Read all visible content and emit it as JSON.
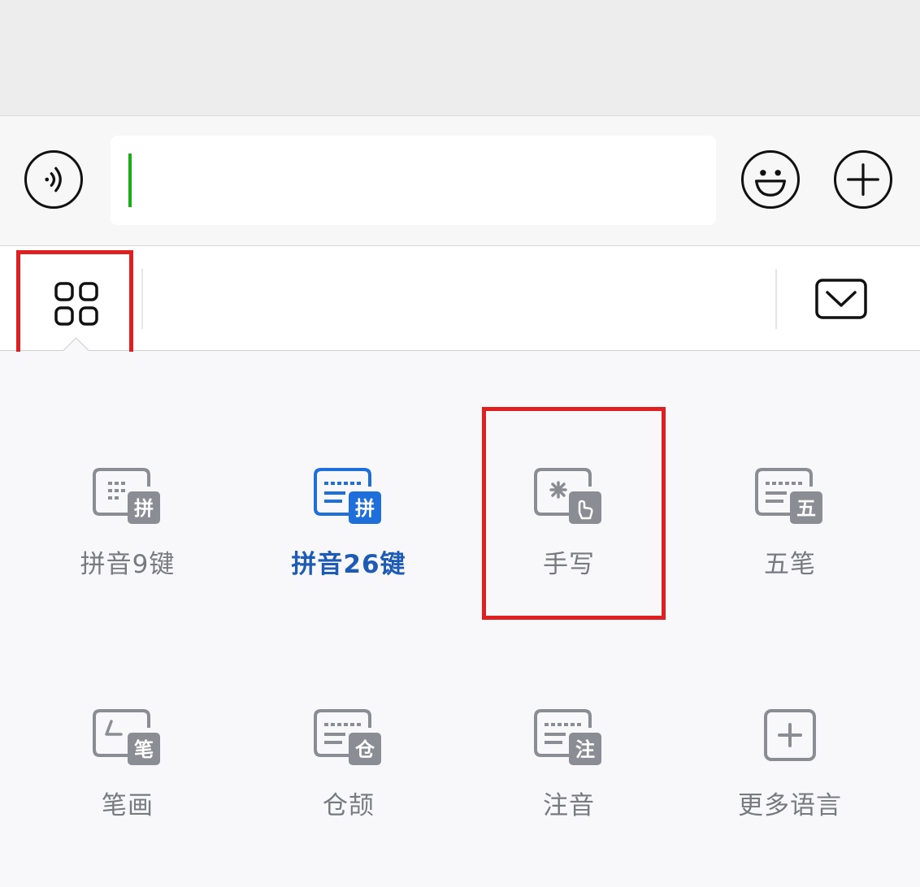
{
  "colors": {
    "highlight": "#e02020",
    "active": "#1e5bb5",
    "inactive": "#777a80",
    "cursor": "#1aad19"
  },
  "input_bar": {
    "voice_icon": "voice-icon",
    "emoji_icon": "emoji-icon",
    "add_icon": "plus-icon",
    "text_value": ""
  },
  "toolbar": {
    "menu_icon": "grid-icon",
    "collapse_icon": "keyboard-collapse-icon"
  },
  "keyboards": [
    {
      "label": "拼音9键",
      "badge": "拼",
      "active": false
    },
    {
      "label": "拼音26键",
      "badge": "拼",
      "active": true
    },
    {
      "label": "手写",
      "badge": "hand",
      "active": false
    },
    {
      "label": "五笔",
      "badge": "五",
      "active": false
    },
    {
      "label": "笔画",
      "badge": "笔",
      "active": false
    },
    {
      "label": "仓颉",
      "badge": "仓",
      "active": false
    },
    {
      "label": "注音",
      "badge": "注",
      "active": false
    },
    {
      "label": "更多语言",
      "badge": "+",
      "active": false
    }
  ]
}
